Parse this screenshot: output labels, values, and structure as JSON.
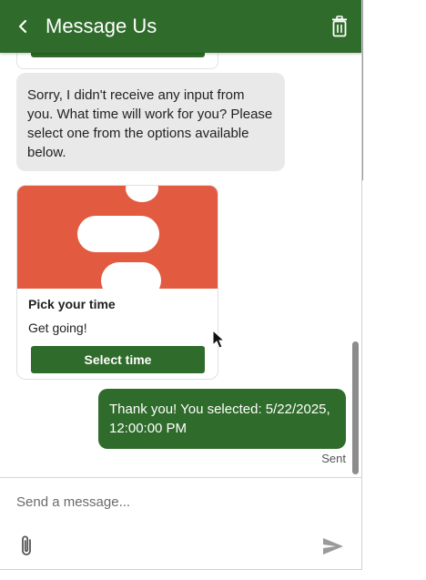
{
  "header": {
    "title": "Message Us",
    "back_icon": "chevron-left-icon",
    "trash_icon": "trash-icon",
    "bg_color": "#2f6b2a"
  },
  "messages": {
    "bot_text": "Sorry, I didn't receive any input from you. What time will work for you? Please select one from the options available below.",
    "card": {
      "title": "Pick your time",
      "subtitle": "Get going!",
      "button_label": "Select time",
      "image_color": "#e25a3f"
    },
    "user_text": "Thank you! You selected: 5/22/2025, 12:00:00 PM",
    "status": "Sent"
  },
  "composer": {
    "placeholder": "Send a message...",
    "attach_icon": "paperclip-icon",
    "send_icon": "send-icon"
  }
}
